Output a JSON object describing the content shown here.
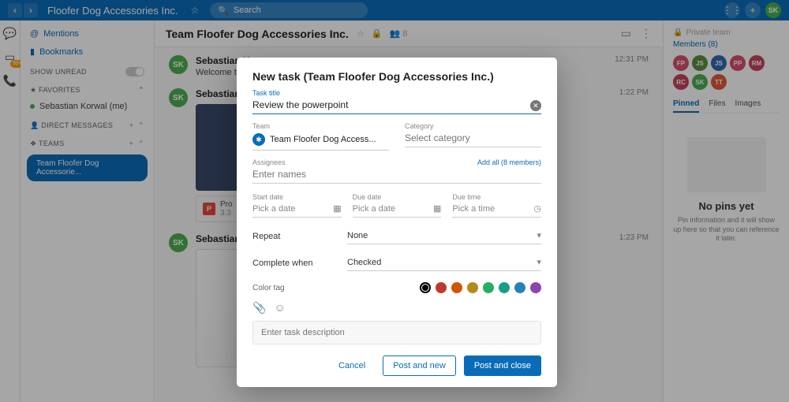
{
  "topbar": {
    "title": "Floofer Dog Accessories Inc.",
    "search_placeholder": "Search",
    "avatar": "SK"
  },
  "sidebar": {
    "mentions": "Mentions",
    "bookmarks": "Bookmarks",
    "show_unread": "SHOW UNREAD",
    "favorites": "FAVORITES",
    "me": "Sebastian Korwal (me)",
    "dm": "DIRECT MESSAGES",
    "teams": "TEAMS",
    "active_team": "Team Floofer Dog Accessorie..."
  },
  "header": {
    "title": "Team Floofer Dog Accessories Inc.",
    "member_count": "8"
  },
  "feed": [
    {
      "name": "Sebastian Ko",
      "time": "12:31 PM",
      "text": "Welcome tea"
    },
    {
      "name": "Sebastian Ko",
      "time": "1:22 PM",
      "file_prefix": "Pro",
      "file_sub": "3.3"
    },
    {
      "name": "Sebastian Ko",
      "time": "1:23 PM"
    }
  ],
  "rpane": {
    "private": "Private team",
    "members_label": "Members (8)",
    "chips": [
      {
        "t": "FP",
        "c": "#d94f6a"
      },
      {
        "t": "JS",
        "c": "#5a8f3f"
      },
      {
        "t": "JS",
        "c": "#2f6ab1"
      },
      {
        "t": "PP",
        "c": "#d94f6a"
      },
      {
        "t": "RM",
        "c": "#c6425a"
      },
      {
        "t": "RC",
        "c": "#c6425a"
      },
      {
        "t": "SK",
        "c": "#4caf50"
      },
      {
        "t": "TT",
        "c": "#e05a3d"
      }
    ],
    "tabs": [
      "Pinned",
      "Files",
      "Images"
    ],
    "empty_title": "No pins yet",
    "empty_body": "Pin information and it will show up here so that you can reference it later."
  },
  "modal": {
    "title": "New task (Team Floofer Dog Accessories Inc.)",
    "task_title_label": "Task title",
    "task_title_value": "Review the powerpoint",
    "team_label": "Team",
    "team_value": "Team Floofer Dog Access...",
    "category_label": "Category",
    "category_placeholder": "Select category",
    "assignees_label": "Assignees",
    "assignees_placeholder": "Enter names",
    "add_all": "Add all (8 members)",
    "start_date_label": "Start date",
    "due_date_label": "Due date",
    "due_time_label": "Due time",
    "pick_date": "Pick a date",
    "pick_time": "Pick a time",
    "repeat_label": "Repeat",
    "repeat_value": "None",
    "complete_label": "Complete when",
    "complete_value": "Checked",
    "color_label": "Color tag",
    "colors": [
      "#000000",
      "#c0392b",
      "#d35400",
      "#b38b1d",
      "#27ae60",
      "#16a085",
      "#2980b9",
      "#8e44ad"
    ],
    "desc_placeholder": "Enter task description",
    "cancel": "Cancel",
    "post_new": "Post and new",
    "post_close": "Post and close"
  }
}
